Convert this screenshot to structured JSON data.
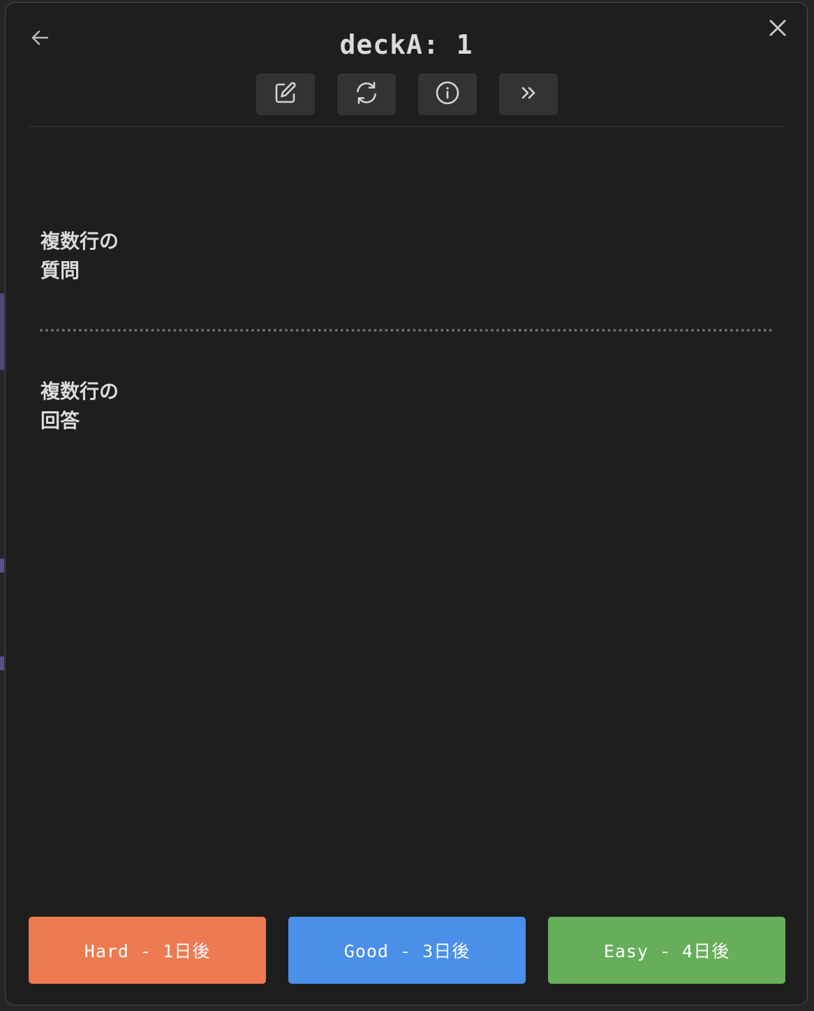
{
  "header": {
    "title": "deckA: 1"
  },
  "toolbar": {
    "buttons": [
      {
        "icon": "edit-icon"
      },
      {
        "icon": "refresh-icon"
      },
      {
        "icon": "info-icon"
      },
      {
        "icon": "skip-forward-icon"
      }
    ]
  },
  "card": {
    "question": "複数行の\n質問",
    "answer": "複数行の\n回答"
  },
  "grades": {
    "hard_label": "Hard - 1日後",
    "good_label": "Good - 3日後",
    "easy_label": "Easy - 4日後"
  },
  "colors": {
    "background": "#1e1e1e",
    "hard": "#ee7a52",
    "good": "#4a90e8",
    "easy": "#67ae5b",
    "text": "#dcdcdc",
    "toolbar_button": "#333333"
  }
}
